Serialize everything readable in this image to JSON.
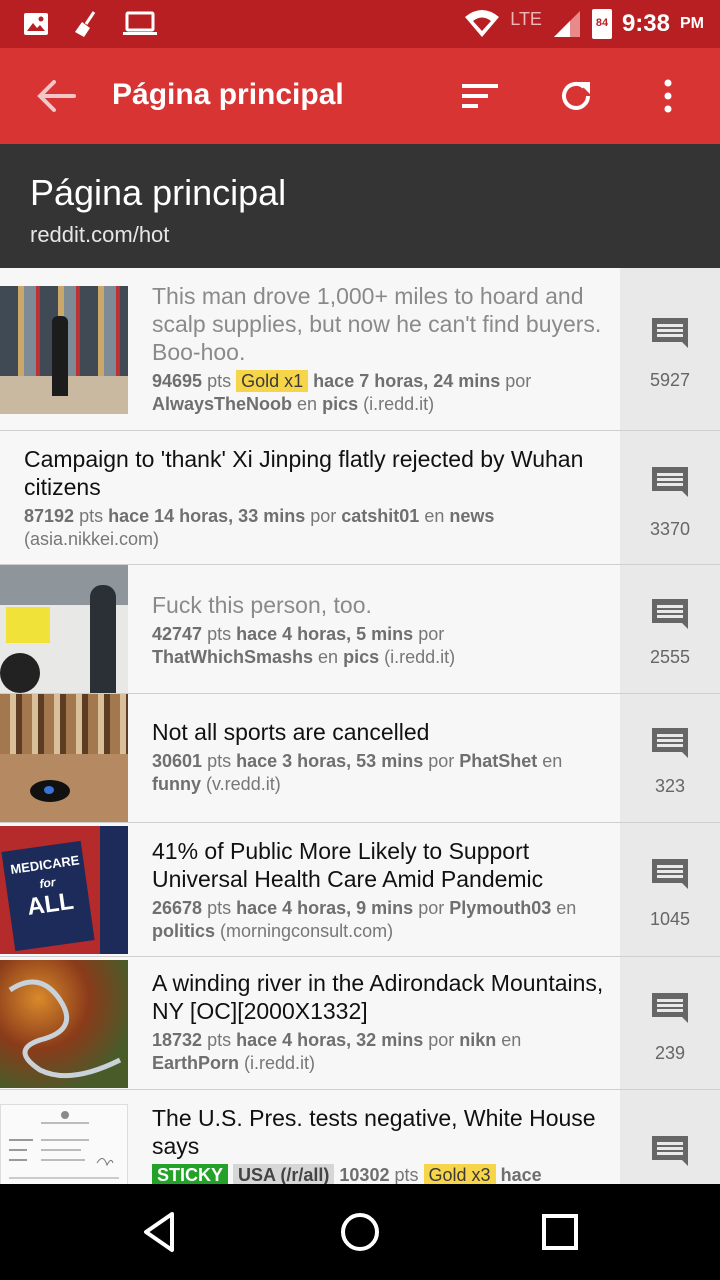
{
  "status_bar": {
    "network": "LTE",
    "battery": "84",
    "time": "9:38",
    "ampm": "PM"
  },
  "app_bar": {
    "title": "Página principal",
    "icons": [
      "arrow-back-icon",
      "sort-icon",
      "refresh-icon",
      "more-vert-icon"
    ]
  },
  "header": {
    "title": "Página principal",
    "subtitle": "reddit.com/hot"
  },
  "posts": [
    {
      "title": "This man drove 1,000+ miles to hoard and scalp supplies, but now he can't find buyers. Boo-hoo.",
      "score": "94695",
      "pts": "pts",
      "gold": "Gold x1",
      "time": "hace 7 horas, 24 mins",
      "por": "por",
      "author": "AlwaysTheNoob",
      "en": "en",
      "subreddit": "pics",
      "domain": "(i.redd.it)",
      "comments": "5927"
    },
    {
      "title": "Campaign to 'thank' Xi Jinping flatly rejected by Wuhan citizens",
      "score": "87192",
      "pts": "pts",
      "time": "hace 14 horas, 33 mins",
      "por": "por",
      "author": "catshit01",
      "en": "en",
      "subreddit": "news",
      "domain": "(asia.nikkei.com)",
      "comments": "3370"
    },
    {
      "title": "Fuck this person, too.",
      "score": "42747",
      "pts": "pts",
      "time": "hace 4 horas, 5 mins",
      "por": "por",
      "author": "ThatWhichSmashs",
      "en": "en",
      "subreddit": "pics",
      "domain": "(i.redd.it)",
      "comments": "2555"
    },
    {
      "title": "Not all sports are cancelled",
      "score": "30601",
      "pts": "pts",
      "time": "hace 3 horas, 53 mins",
      "por": "por",
      "author": "PhatShet",
      "en": "en",
      "subreddit": "funny",
      "domain": "(v.redd.it)",
      "comments": "323"
    },
    {
      "title": "41% of Public More Likely to Support Universal Health Care Amid Pandemic",
      "score": "26678",
      "pts": "pts",
      "time": "hace 4 horas, 9 mins",
      "por": "por",
      "author": "Plymouth03",
      "en": "en",
      "subreddit": "politics",
      "domain": "(morningconsult.com)",
      "comments": "1045",
      "thumb_text": [
        "MEDICARE",
        "for",
        "ALL"
      ]
    },
    {
      "title": "A winding river in the Adirondack Mountains, NY [OC][2000X1332]",
      "score": "18732",
      "pts": "pts",
      "time": "hace 4 horas, 32 mins",
      "por": "por",
      "author": "nikn",
      "en": "en",
      "subreddit": "EarthPorn",
      "domain": "(i.redd.it)",
      "comments": "239"
    },
    {
      "title": "The U.S. Pres. tests negative, White House says",
      "sticky": "STICKY",
      "all_badge": "USA (/r/all)",
      "score": "10302",
      "pts": "pts",
      "gold": "Gold x3",
      "time": "hace"
    }
  ],
  "nav_bar": {
    "icons": [
      "back-triangle-icon",
      "home-circle-icon",
      "recents-square-icon"
    ]
  }
}
